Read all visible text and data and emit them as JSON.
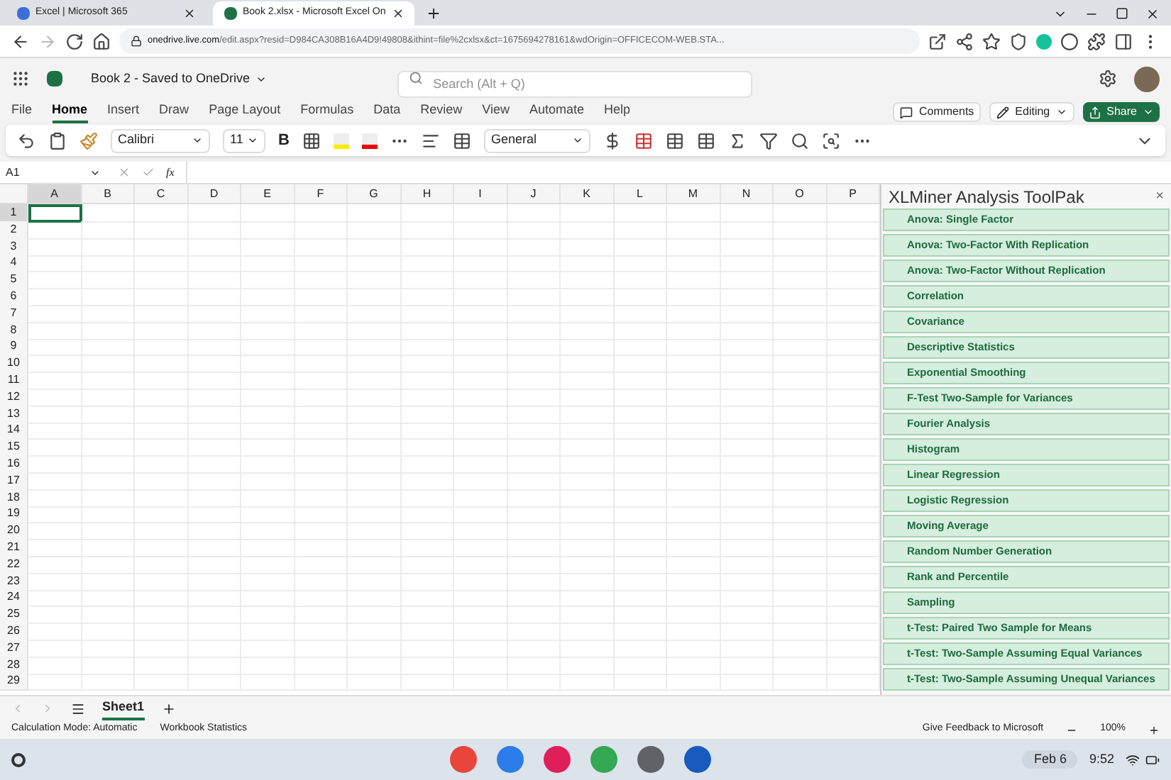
{
  "browser_tabs": [
    {
      "title": "Excel | Microsoft 365",
      "selected": false
    },
    {
      "title": "Book 2.xlsx - Microsoft Excel On",
      "selected": true
    }
  ],
  "address": {
    "host": "onedrive.live.com",
    "path": "/edit.aspx?resid=D984CA308B16A4D9!49808&ithint=file%2cxlsx&ct=1675694278161&wdOrigin=OFFICECOM-WEB.STA..."
  },
  "app_header": {
    "title": "Book 2 - Saved to OneDrive",
    "search_placeholder": "Search (Alt + Q)"
  },
  "ribbon_tabs": [
    {
      "label": "File",
      "selected": false
    },
    {
      "label": "Home",
      "selected": true
    },
    {
      "label": "Insert",
      "selected": false
    },
    {
      "label": "Draw",
      "selected": false
    },
    {
      "label": "Page Layout",
      "selected": false
    },
    {
      "label": "Formulas",
      "selected": false
    },
    {
      "label": "Data",
      "selected": false
    },
    {
      "label": "Review",
      "selected": false
    },
    {
      "label": "View",
      "selected": false
    },
    {
      "label": "Automate",
      "selected": false
    },
    {
      "label": "Help",
      "selected": false
    }
  ],
  "ribbon_buttons": {
    "comments": "Comments",
    "editing": "Editing",
    "share": "Share"
  },
  "toolbar": {
    "font": "Calibri",
    "size": "11",
    "bold": "B",
    "number_format": "General"
  },
  "formula_bar": {
    "name_box": "A1",
    "fx": "fx"
  },
  "grid": {
    "columns": [
      {
        "label": "A",
        "selected": true
      },
      {
        "label": "B",
        "selected": false
      },
      {
        "label": "C",
        "selected": false
      },
      {
        "label": "D",
        "selected": false
      },
      {
        "label": "E",
        "selected": false
      },
      {
        "label": "F",
        "selected": false
      },
      {
        "label": "G",
        "selected": false
      },
      {
        "label": "H",
        "selected": false
      },
      {
        "label": "I",
        "selected": false
      },
      {
        "label": "J",
        "selected": false
      },
      {
        "label": "K",
        "selected": false
      },
      {
        "label": "L",
        "selected": false
      },
      {
        "label": "M",
        "selected": false
      },
      {
        "label": "N",
        "selected": false
      },
      {
        "label": "O",
        "selected": false
      },
      {
        "label": "P",
        "selected": false
      }
    ],
    "rows": [
      {
        "label": "1",
        "selected": true
      },
      {
        "label": "2",
        "selected": false
      },
      {
        "label": "3",
        "selected": false
      },
      {
        "label": "4",
        "selected": false
      },
      {
        "label": "5",
        "selected": false
      },
      {
        "label": "6",
        "selected": false
      },
      {
        "label": "7",
        "selected": false
      },
      {
        "label": "8",
        "selected": false
      },
      {
        "label": "9",
        "selected": false
      },
      {
        "label": "10",
        "selected": false
      },
      {
        "label": "11",
        "selected": false
      },
      {
        "label": "12",
        "selected": false
      },
      {
        "label": "13",
        "selected": false
      },
      {
        "label": "14",
        "selected": false
      },
      {
        "label": "15",
        "selected": false
      },
      {
        "label": "16",
        "selected": false
      },
      {
        "label": "17",
        "selected": false
      },
      {
        "label": "18",
        "selected": false
      },
      {
        "label": "19",
        "selected": false
      },
      {
        "label": "20",
        "selected": false
      },
      {
        "label": "21",
        "selected": false
      },
      {
        "label": "22",
        "selected": false
      },
      {
        "label": "23",
        "selected": false
      },
      {
        "label": "24",
        "selected": false
      },
      {
        "label": "25",
        "selected": false
      },
      {
        "label": "26",
        "selected": false
      },
      {
        "label": "27",
        "selected": false
      },
      {
        "label": "28",
        "selected": false
      },
      {
        "label": "29",
        "selected": false
      }
    ]
  },
  "panel": {
    "title": "XLMiner Analysis ToolPak",
    "close": "×",
    "items": [
      "Anova: Single Factor",
      "Anova: Two-Factor With Replication",
      "Anova: Two-Factor Without Replication",
      "Correlation",
      "Covariance",
      "Descriptive Statistics",
      "Exponential Smoothing",
      "F-Test Two-Sample for Variances",
      "Fourier Analysis",
      "Histogram",
      "Linear Regression",
      "Logistic Regression",
      "Moving Average",
      "Random Number Generation",
      "Rank and Percentile",
      "Sampling",
      "t-Test: Paired Two Sample for Means",
      "t-Test: Two-Sample Assuming Equal Variances",
      "t-Test: Two-Sample Assuming Unequal Variances"
    ]
  },
  "sheet_tabs": [
    {
      "label": "Sheet1",
      "selected": true
    }
  ],
  "status_bar": {
    "left": [
      "Calculation Mode: Automatic",
      "Workbook Statistics"
    ],
    "feedback": "Give Feedback to Microsoft",
    "zoom": "100%"
  },
  "shelf": {
    "date": "Feb 6",
    "time": "9:52"
  }
}
